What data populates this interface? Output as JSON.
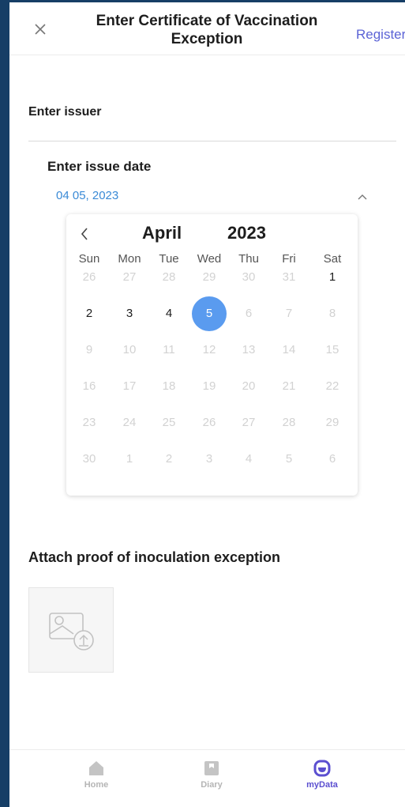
{
  "header": {
    "title_line1": "Enter Certificate of Vaccination",
    "title_line2": "Exception",
    "close_icon": "close-icon",
    "register_label": "Register"
  },
  "form": {
    "issuer_label": "Enter issuer",
    "issue_date_label": "Enter issue date",
    "issue_date_value": "04 05, 2023"
  },
  "calendar": {
    "month": "April",
    "year": "2023",
    "weekdays": [
      "Sun",
      "Mon",
      "Tue",
      "Wed",
      "Thu",
      "Fri",
      "Sat"
    ],
    "weeks": [
      [
        "26",
        "27",
        "28",
        "29",
        "30",
        "31",
        "1"
      ],
      [
        "2",
        "3",
        "4",
        "5",
        "6",
        "7",
        "8"
      ],
      [
        "9",
        "10",
        "11",
        "12",
        "13",
        "14",
        "15"
      ],
      [
        "16",
        "17",
        "18",
        "19",
        "20",
        "21",
        "22"
      ],
      [
        "23",
        "24",
        "25",
        "26",
        "27",
        "28",
        "29"
      ],
      [
        "30",
        "1",
        "2",
        "3",
        "4",
        "5",
        "6"
      ]
    ],
    "selected_day": "5",
    "enabled_days": [
      "1",
      "2",
      "3",
      "4",
      "5"
    ],
    "selected_color": "#5a9bef"
  },
  "attach": {
    "label": "Attach proof of inoculation exception",
    "upload_icon": "image-upload-icon"
  },
  "bottom_nav": [
    {
      "label": "Home",
      "icon": "home-icon",
      "active": false
    },
    {
      "label": "Diary",
      "icon": "diary-icon",
      "active": false
    },
    {
      "label": "myData",
      "icon": "mydata-icon",
      "active": true
    }
  ],
  "colors": {
    "accent": "#5b63d6",
    "date_text": "#3a8ad6",
    "frame": "#163e66"
  }
}
